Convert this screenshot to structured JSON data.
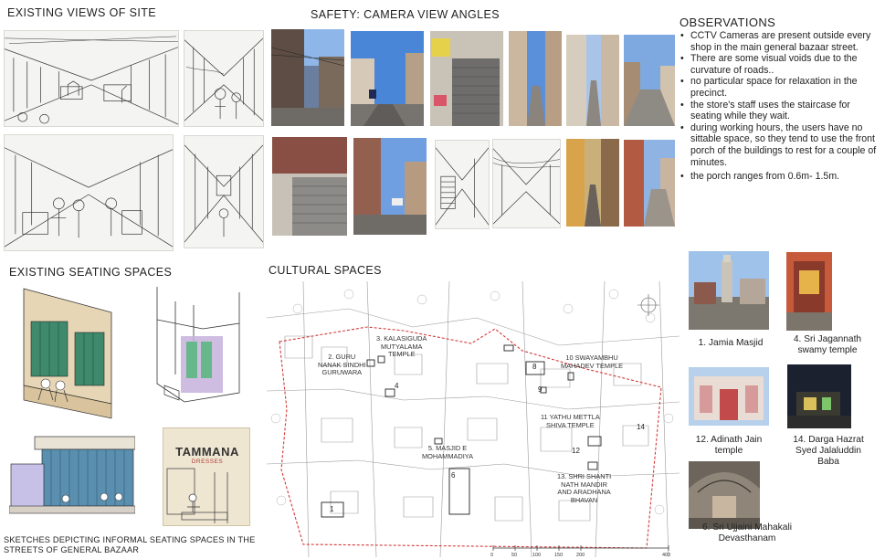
{
  "headings": {
    "existing_views": "EXISTING VIEWS OF SITE",
    "safety": "SAFETY: CAMERA VIEW ANGLES",
    "observations": "OBSERVATIONS",
    "seating": "EXISTING SEATING SPACES",
    "cultural": "CULTURAL SPACES"
  },
  "observations": [
    "CCTV Cameras are present outside every shop in the main general bazaar street.",
    "There are some visual voids due to the curvature of roads..",
    "no particular space for relaxation in the precinct.",
    "the store's staff uses the staircase for seating while they wait.",
    "during working hours, the users have no sittable space, so they tend to use the front porch of the buildings to rest for a couple of minutes.",
    "the porch ranges from 0.6m- 1.5m."
  ],
  "seating_note": "SKETCHES DEPICTING INFORMAL SEATING SPACES IN THE STREETS OF GENERAL BAZAAR",
  "sign": {
    "line1": "TAMMANA",
    "line2": "DRESSES"
  },
  "map_labels": {
    "l2": "2. GURU\nNANAK SINDHI\nGURUWARA",
    "l3": "3. KALASIGUDA\nMUTYALAMA\nTEMPLE",
    "l4": "4",
    "l5": "5. MASJID E\nMOHAMMADIYA",
    "l6": "6",
    "l8": "8",
    "l9": "9",
    "l10": "10 SWAYAMBHU\nMAHADEV TEMPLE",
    "l11": "11 YATHU METTLA\nSHIVA TEMPLE",
    "l12": "12",
    "l13": "13. SHRI SHANTI\nNATH MANDIR\nAND ARADHANA\nBHAVAN",
    "l14": "14",
    "l1": "1"
  },
  "scale": [
    "0",
    "50",
    "100",
    "150",
    "200",
    "400"
  ],
  "cultural_photos": [
    {
      "caption": "1. Jamia Masjid"
    },
    {
      "caption": "4. Sri Jagannath\nswamy temple"
    },
    {
      "caption": "12. Adinath Jain\ntemple"
    },
    {
      "caption": "14. Darga Hazrat\nSyed Jalaluddin\nBaba"
    },
    {
      "caption": "6. Sri Ujjaini Mahakali\nDevasthanam"
    }
  ],
  "colors": {
    "boundary": "#d23a3a",
    "sky": "#5b8fd6",
    "green_shutter": "#3f8a6c",
    "purple_wash": "#b9a2cf"
  }
}
